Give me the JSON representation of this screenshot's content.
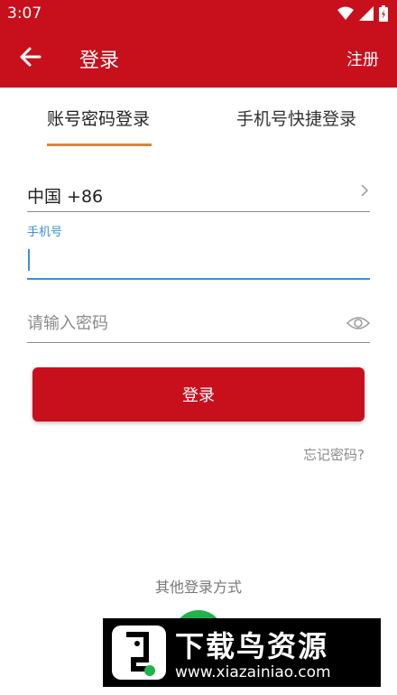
{
  "status_bar": {
    "time": "3:07",
    "icons": [
      "wifi-icon",
      "signal-icon",
      "battery-icon"
    ]
  },
  "toolbar": {
    "back_icon": "arrow-left-icon",
    "title": "登录",
    "register_label": "注册"
  },
  "tabs": [
    {
      "label": "账号密码登录",
      "active": true
    },
    {
      "label": "手机号快捷登录",
      "active": false
    }
  ],
  "form": {
    "country": "中国 +86",
    "phone_label": "手机号",
    "phone_value": "",
    "password_placeholder": "请输入密码",
    "login_label": "登录",
    "forgot_label": "忘记密码?"
  },
  "other_login": {
    "title": "其他登录方式"
  },
  "watermark": {
    "text": "下载鸟资源",
    "url": "www.xiazainiao.com"
  },
  "colors": {
    "primary": "#c8101c",
    "accent_blue": "#3d8fd6",
    "tab_indicator": "#d4893a",
    "social_green": "#21b24a"
  }
}
